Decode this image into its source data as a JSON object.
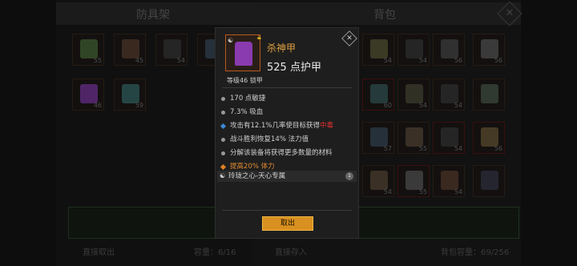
{
  "left_panel": {
    "title": "防具架",
    "footer_action": "直接取出",
    "capacity": "容量：6/16"
  },
  "right_panel": {
    "title": "背包",
    "footer_action": "直接存入",
    "capacity": "背包容量：69/256"
  },
  "close_icon": "✕",
  "left_slots": [
    {
      "level": "55",
      "color": "#4a6a3a"
    },
    {
      "level": "45",
      "color": "#5a4030"
    },
    {
      "level": "54",
      "color": "#3a3a3a"
    },
    {
      "level": "54",
      "color": "#3a4a5a"
    },
    {
      "level": "46",
      "color": "#7a3aa0"
    },
    {
      "level": "59",
      "color": "#3a6a6a"
    }
  ],
  "right_slots": [
    {
      "level": "54",
      "color": "#5a5a3a"
    },
    {
      "level": "54",
      "color": "#3a3a3a"
    },
    {
      "level": "56",
      "color": "#4a4a4a"
    },
    {
      "level": "56",
      "color": "#5a5a5a"
    },
    {
      "level": "60",
      "color": "#3a5a5a"
    },
    {
      "level": "54",
      "color": "#4a4a3a"
    },
    {
      "level": "54",
      "color": "#3a3a3a"
    },
    {
      "level": "",
      "color": "#4a5a4a"
    },
    {
      "level": "57",
      "color": "#3a4a5a"
    },
    {
      "level": "55",
      "color": "#5a4a3a"
    },
    {
      "level": "54",
      "color": "#3a3a3a"
    },
    {
      "level": "56",
      "color": "#6a5a3a"
    },
    {
      "level": "54",
      "color": "#5a4a3a"
    },
    {
      "level": "55",
      "color": "#5a5a5a"
    },
    {
      "level": "54",
      "color": "#5a4030"
    },
    {
      "level": "",
      "color": "#3a3a4a"
    },
    {
      "level": "",
      "color": "#3a3a3a"
    },
    {
      "level": "",
      "color": "#4a3a2a"
    }
  ],
  "tooltip": {
    "item_name": "杀神甲",
    "armor_value": "525 点护甲",
    "subtitle": "等级46 锁甲",
    "stats": {
      "s1": "170 点敏捷",
      "s2": "7.3% 吸血",
      "s3_main": "攻击有12.1%几率使目标获得",
      "s3_red": "中毒",
      "s4": "战斗胜利恢复14% 法力值",
      "s5": "分解该装备将获得更多数量的材料",
      "s6": "提高20% 体力"
    },
    "set_name": "玲珑之心-天心专属",
    "set_count": "1",
    "cancel_label": "取出",
    "item_color": "#8a3bb0",
    "name_color": "#e0a040"
  }
}
